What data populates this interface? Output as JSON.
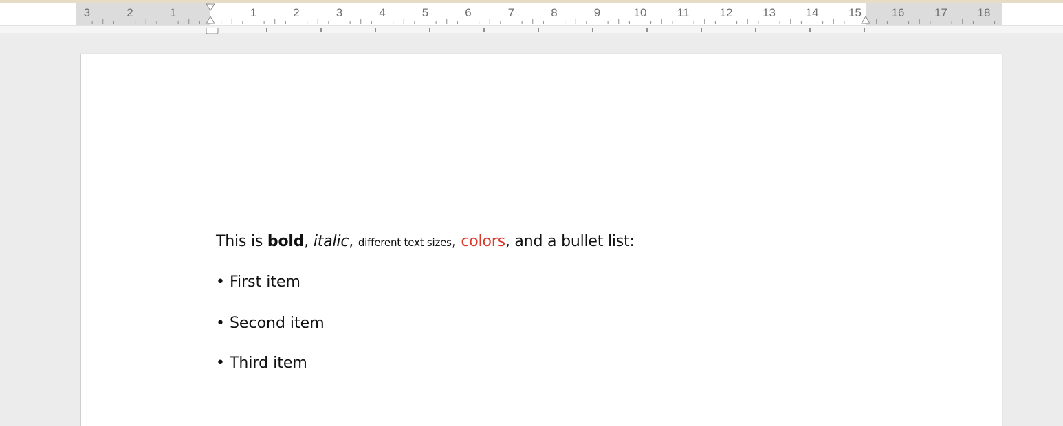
{
  "ruler": {
    "left_numbers": [
      "3",
      "2",
      "1"
    ],
    "right_numbers": [
      "1",
      "2",
      "3",
      "4",
      "5",
      "6",
      "7",
      "8",
      "9",
      "10",
      "11",
      "12",
      "13",
      "14",
      "15",
      "16",
      "17",
      "18"
    ]
  },
  "document": {
    "line1": {
      "prefix": "This is ",
      "bold": "bold",
      "sep1": ", ",
      "italic": "italic",
      "sep2": ", ",
      "small": "different text sizes",
      "sep3": ", ",
      "colored": "colors",
      "suffix": ", and a bullet list:"
    },
    "bullets": [
      "• First item",
      "• Second item",
      "• Third item"
    ]
  },
  "colors": {
    "highlight_text": "#d93a2b",
    "ruler_margin": "#dcdcdc",
    "canvas": "#ececec"
  }
}
